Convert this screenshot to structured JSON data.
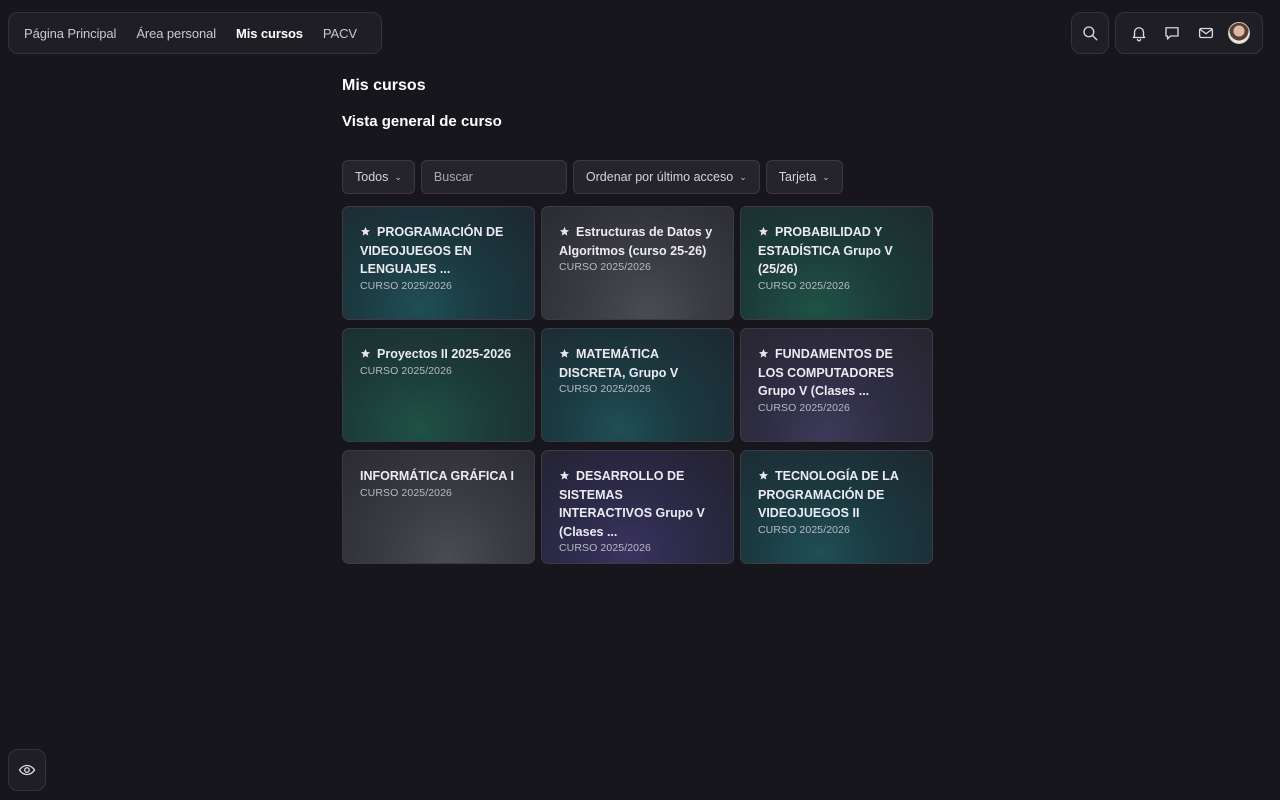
{
  "nav": {
    "links": [
      "Página Principal",
      "Área personal",
      "Mis cursos",
      "PACV"
    ],
    "active_index": 2
  },
  "header_icons": [
    "search-icon",
    "bell-icon",
    "chat-icon",
    "mail-icon",
    "avatar"
  ],
  "main": {
    "page_title": "Mis cursos",
    "section_title": "Vista general de curso",
    "filters": {
      "group": "Todos",
      "search_placeholder": "Buscar",
      "sort": "Ordenar por último acceso",
      "view": "Tarjeta"
    },
    "courses": [
      {
        "title": "PROGRAMACIÓN DE VIDEOJUEGOS EN LENGUAJES ...",
        "category": "CURSO 2025/2026",
        "starred": true,
        "color": "teal"
      },
      {
        "title": "Estructuras de Datos y Algoritmos (curso 25-26)",
        "category": "CURSO 2025/2026",
        "starred": true,
        "color": "gray"
      },
      {
        "title": "PROBABILIDAD Y ESTADÍSTICA Grupo V (25/26)",
        "category": "CURSO 2025/2026",
        "starred": true,
        "color": "green"
      },
      {
        "title": "Proyectos II 2025-2026",
        "category": "CURSO 2025/2026",
        "starred": true,
        "color": "green"
      },
      {
        "title": "MATEMÁTICA DISCRETA, Grupo V",
        "category": "CURSO 2025/2026",
        "starred": true,
        "color": "teal"
      },
      {
        "title": "FUNDAMENTOS DE LOS COMPUTADORES Grupo V (Clases ...",
        "category": "CURSO 2025/2026",
        "starred": true,
        "color": "slate"
      },
      {
        "title": "INFORMÁTICA GRÁFICA I",
        "category": "CURSO 2025/2026",
        "starred": false,
        "color": "gray"
      },
      {
        "title": "DESARROLLO DE SISTEMAS INTERACTIVOS Grupo V (Clases ...",
        "category": "CURSO 2025/2026",
        "starred": true,
        "color": "purple"
      },
      {
        "title": "TECNOLOGÍA DE LA PROGRAMACIÓN DE VIDEOJUEGOS II",
        "category": "CURSO 2025/2026",
        "starred": true,
        "color": "teal"
      }
    ]
  },
  "accessibility_icon": "eye-icon"
}
